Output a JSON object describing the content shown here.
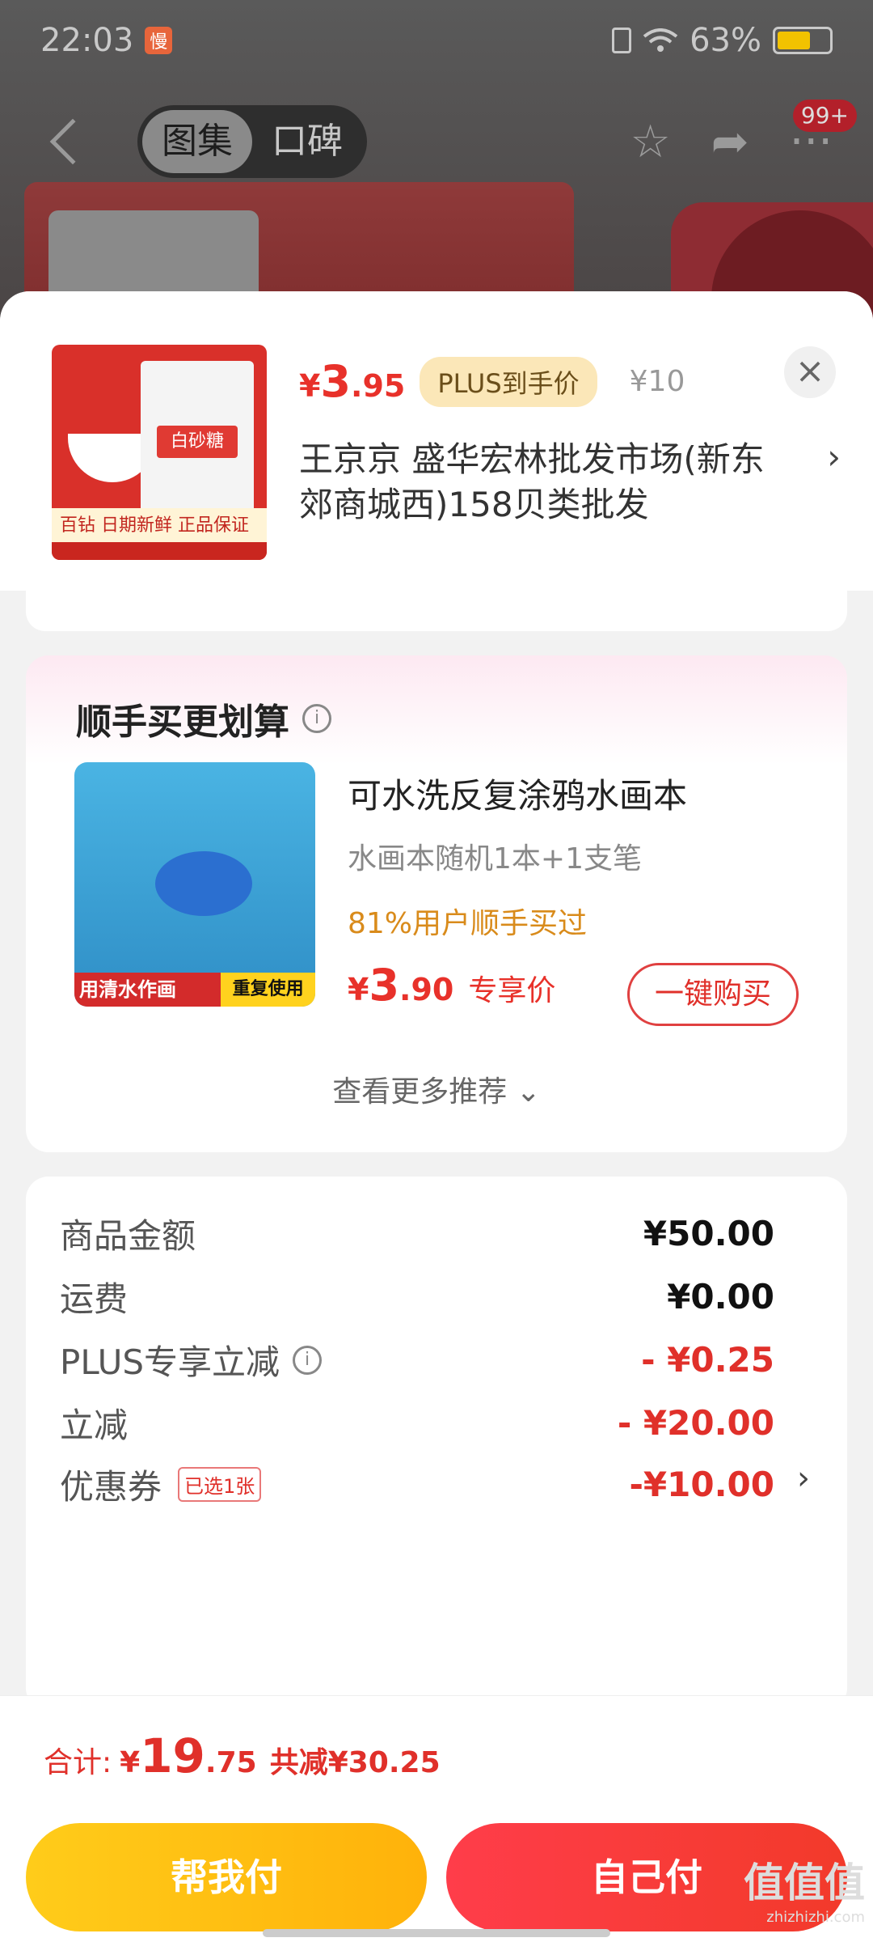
{
  "status_bar": {
    "time": "22:03",
    "battery": "63%"
  },
  "top_nav": {
    "tabs": [
      "图集",
      "口碑"
    ],
    "active_tab": 0,
    "notification_count": "99+"
  },
  "product": {
    "price_currency": "¥",
    "price_int": "3",
    "price_dec": ".95",
    "plus_label": "PLUS到手价",
    "original_price": "¥10",
    "shop_name": "王京京  盛华宏林批发市场(新东郊商城西)158贝类批发",
    "thumb_brand": "百钻",
    "thumb_bag_label": "白砂糖",
    "thumb_tag": "日期新鲜 正品保证"
  },
  "bundle": {
    "title": "顺手买更划算",
    "item_name": "可水洗反复涂鸦水画本",
    "item_spec": "水画本随机1本+1支笔",
    "ratio_text": "81%用户顺手买过",
    "price_currency": "¥",
    "price_int": "3",
    "price_dec": ".90",
    "price_label": "专享价",
    "buy_button": "一键购买",
    "more": "查看更多推荐 ⌄",
    "img_text_a": "用清水作画",
    "img_text_b": "重复使用"
  },
  "summary": {
    "rows": [
      {
        "label": "商品金额",
        "value": "¥50.00"
      },
      {
        "label": "运费",
        "value": "¥0.00"
      },
      {
        "label": "PLUS专享立减",
        "value": "- ¥0.25"
      },
      {
        "label": "立减",
        "value": "- ¥20.00"
      },
      {
        "label": "优惠券",
        "value": "-¥10.00",
        "tag": "已选1张"
      }
    ]
  },
  "bottom": {
    "total_label": "合计:",
    "total_currency": "¥",
    "total_int": "19",
    "total_dec": ".75",
    "saved": "共减¥30.25",
    "help_pay": "帮我付",
    "self_pay": "自己付"
  },
  "watermark": {
    "main": "值值值",
    "sub": "zhizhizhi.com"
  },
  "colors": {
    "accent_red": "#e8312a",
    "yellow": "#ffc21a",
    "plus_gold": "#fbe7b8"
  }
}
